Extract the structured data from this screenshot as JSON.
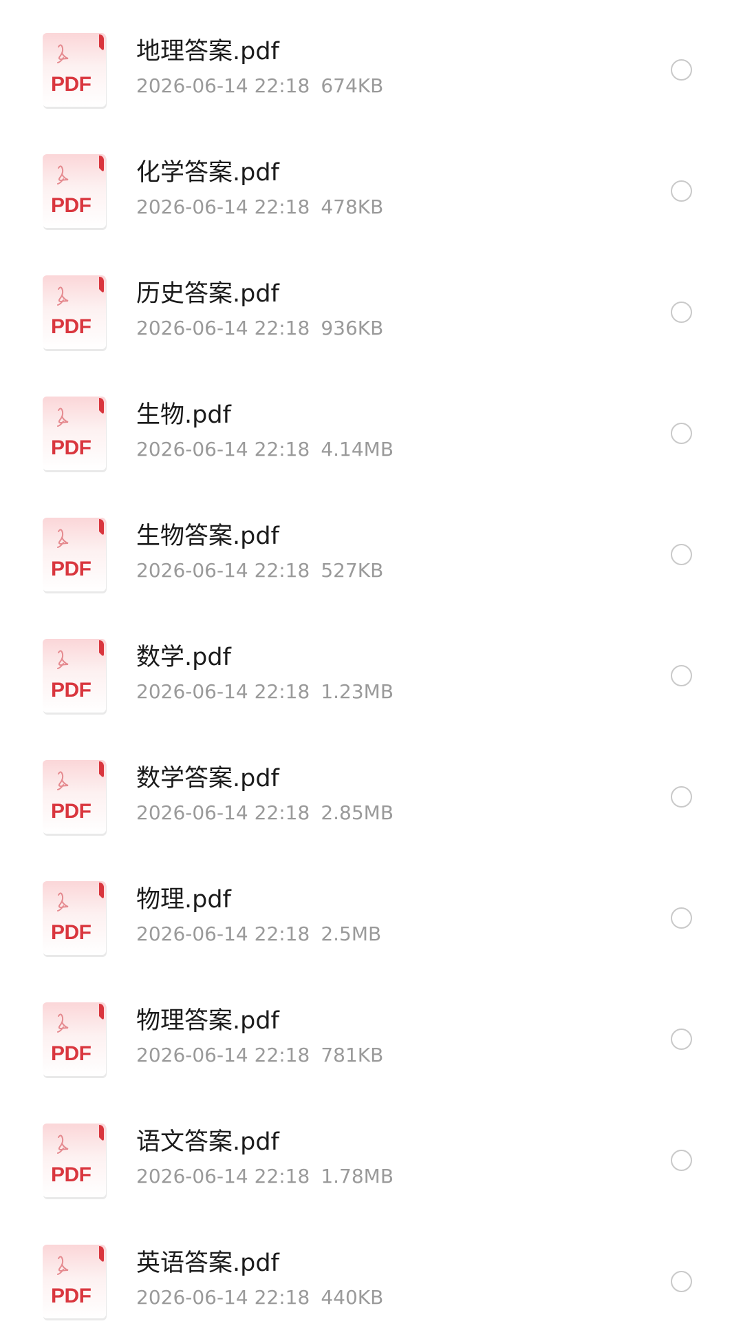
{
  "colors": {
    "background": "#ffffff",
    "title_text": "#1b1b1b",
    "meta_text": "#9a9a9a",
    "pdf_red": "#d9363e",
    "radio_border": "#c9c9c9"
  },
  "icon": {
    "name": "pdf-file-icon",
    "label": "PDF"
  },
  "files": [
    {
      "name": "地理答案.pdf",
      "date": "2026-06-14 22:18",
      "size": "674KB",
      "selected": false
    },
    {
      "name": "化学答案.pdf",
      "date": "2026-06-14 22:18",
      "size": "478KB",
      "selected": false
    },
    {
      "name": "历史答案.pdf",
      "date": "2026-06-14 22:18",
      "size": "936KB",
      "selected": false
    },
    {
      "name": "生物.pdf",
      "date": "2026-06-14 22:18",
      "size": "4.14MB",
      "selected": false
    },
    {
      "name": "生物答案.pdf",
      "date": "2026-06-14 22:18",
      "size": "527KB",
      "selected": false
    },
    {
      "name": "数学.pdf",
      "date": "2026-06-14 22:18",
      "size": "1.23MB",
      "selected": false
    },
    {
      "name": "数学答案.pdf",
      "date": "2026-06-14 22:18",
      "size": "2.85MB",
      "selected": false
    },
    {
      "name": "物理.pdf",
      "date": "2026-06-14 22:18",
      "size": "2.5MB",
      "selected": false
    },
    {
      "name": "物理答案.pdf",
      "date": "2026-06-14 22:18",
      "size": "781KB",
      "selected": false
    },
    {
      "name": "语文答案.pdf",
      "date": "2026-06-14 22:18",
      "size": "1.78MB",
      "selected": false
    },
    {
      "name": "英语答案.pdf",
      "date": "2026-06-14 22:18",
      "size": "440KB",
      "selected": false
    }
  ]
}
